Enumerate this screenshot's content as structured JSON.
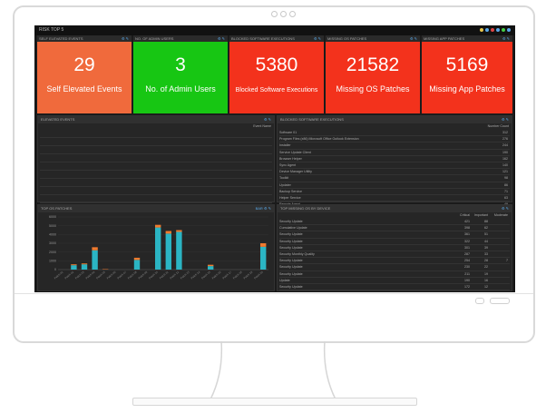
{
  "dashboard": {
    "title": "RISK TOP 5",
    "topbar_dot_colors": [
      "#e8c54a",
      "#59a8e8",
      "#d44",
      "#59a8e8",
      "#4c4",
      "#59a8e8"
    ]
  },
  "tiles": [
    {
      "title": "SELF ELEVATED EVENTS",
      "value": "29",
      "label": "Self Elevated Events",
      "color": "#f06a3c"
    },
    {
      "title": "NO. OF ADMIN USERS",
      "value": "3",
      "label": "No. of Admin Users",
      "color": "#17c613"
    },
    {
      "title": "BLOCKED SOFTWARE EXECUTIONS",
      "value": "5380",
      "label": "Blocked Software Executions",
      "color": "#f3321c"
    },
    {
      "title": "MISSING OS PATCHES",
      "value": "21582",
      "label": "Missing OS Patches",
      "color": "#f3321c"
    },
    {
      "title": "MISSING APP PATCHES",
      "value": "5169",
      "label": "Missing App Patches",
      "color": "#f3321c"
    }
  ],
  "panels": {
    "elevated_events": {
      "title": "ELEVATED EVENTS",
      "subheader": "Event Name",
      "rows": 10
    },
    "software_executions": {
      "title": "BLOCKED SOFTWARE EXECUTIONS",
      "subheader": "Number Count",
      "rows": [
        {
          "name": "Software 01",
          "value": "312"
        },
        {
          "name": "Program Files (x86) Microsoft Office Outlook Extension",
          "value": "276"
        },
        {
          "name": "Installer",
          "value": "244"
        },
        {
          "name": "Service Update Client",
          "value": "190"
        },
        {
          "name": "Browser Helper",
          "value": "162"
        },
        {
          "name": "Sync Agent",
          "value": "140"
        },
        {
          "name": "Device Manager Utility",
          "value": "121"
        },
        {
          "name": "Toolkit",
          "value": "98"
        },
        {
          "name": "Updater",
          "value": "86"
        },
        {
          "name": "Backup Service",
          "value": "71"
        },
        {
          "name": "Helper Service",
          "value": "63"
        },
        {
          "name": "Remote Agent",
          "value": "49"
        },
        {
          "name": "Driver Installer Utility",
          "value": "37"
        },
        {
          "name": "Device Manager Utility",
          "value": "24"
        }
      ]
    },
    "os_patches_chart": {
      "title": "TOP OS PATCHES",
      "badge": "BAR"
    },
    "missing_os_by_device": {
      "title": "TOP MISSING OS BY DEVICE",
      "columns": [
        "Critical",
        "Important",
        "Moderate"
      ],
      "rows": [
        {
          "name": "Security Update",
          "c1": "421",
          "c2": "88",
          "c3": ""
        },
        {
          "name": "Cumulative Update",
          "c1": "398",
          "c2": "62",
          "c3": ""
        },
        {
          "name": "Security Update",
          "c1": "361",
          "c2": "51",
          "c3": ""
        },
        {
          "name": "Security Update",
          "c1": "322",
          "c2": "44",
          "c3": ""
        },
        {
          "name": "Security Update",
          "c1": "301",
          "c2": "39",
          "c3": ""
        },
        {
          "name": "Security Monthly Quality",
          "c1": "287",
          "c2": "33",
          "c3": ""
        },
        {
          "name": "Security Update",
          "c1": "254",
          "c2": "28",
          "c3": "7"
        },
        {
          "name": "Security Update",
          "c1": "230",
          "c2": "22",
          "c3": ""
        },
        {
          "name": "Security Update",
          "c1": "211",
          "c2": "19",
          "c3": ""
        },
        {
          "name": "Update",
          "c1": "190",
          "c2": "16",
          "c3": ""
        },
        {
          "name": "Security Update",
          "c1": "172",
          "c2": "12",
          "c3": ""
        },
        {
          "name": "Security Update",
          "c1": "150",
          "c2": "9",
          "c3": ""
        },
        {
          "name": "Security Update",
          "c1": "131",
          "c2": "7",
          "c3": ""
        },
        {
          "name": "Security Update",
          "c1": "112",
          "c2": "5",
          "c3": ""
        }
      ]
    }
  },
  "chart_data": {
    "type": "bar",
    "stacked": true,
    "categories": [
      "Patch 01",
      "Patch 02",
      "Patch 03",
      "Patch 04",
      "Patch 05",
      "Patch 06",
      "Patch 07",
      "Patch 08",
      "Patch 09",
      "Patch 10",
      "Patch 11",
      "Patch 12",
      "Patch 13",
      "Patch 14",
      "Patch 15",
      "Patch 16",
      "Patch 17",
      "Patch 18",
      "Patch 19",
      "Patch 20"
    ],
    "series": [
      {
        "name": "",
        "color": "#2bb5c4",
        "values": [
          0,
          500,
          600,
          2200,
          0,
          0,
          0,
          1100,
          0,
          4800,
          4100,
          4300,
          0,
          0,
          400,
          0,
          0,
          0,
          0,
          2600
        ]
      },
      {
        "name": "",
        "color": "#f07a2e",
        "values": [
          0,
          100,
          100,
          350,
          50,
          0,
          0,
          250,
          0,
          300,
          300,
          200,
          0,
          0,
          150,
          0,
          0,
          0,
          0,
          400
        ]
      }
    ],
    "ylim": [
      0,
      6000
    ],
    "yticks": [
      "6000",
      "5000",
      "4000",
      "3000",
      "2000",
      "1000",
      "0"
    ]
  }
}
